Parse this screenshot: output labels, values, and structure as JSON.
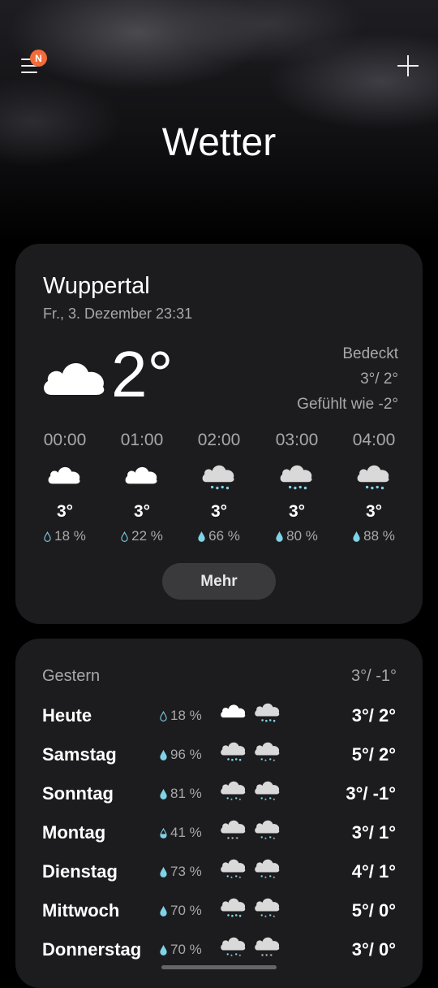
{
  "header": {
    "menu_badge": "N",
    "title": "Wetter"
  },
  "current": {
    "city": "Wuppertal",
    "datetime": "Fr., 3. Dezember 23:31",
    "temperature": "2°",
    "condition": "Bedeckt",
    "high_low": "3°/ 2°",
    "feels_like": "Gefühlt wie -2°",
    "icon": "cloud-icon",
    "more_label": "Mehr"
  },
  "hourly": [
    {
      "time": "00:00",
      "icon": "cloud",
      "temp": "3°",
      "precip": "18 %"
    },
    {
      "time": "01:00",
      "icon": "cloud",
      "temp": "3°",
      "precip": "22 %"
    },
    {
      "time": "02:00",
      "icon": "rain",
      "temp": "3°",
      "precip": "66 %"
    },
    {
      "time": "03:00",
      "icon": "rain",
      "temp": "3°",
      "precip": "80 %"
    },
    {
      "time": "04:00",
      "icon": "rain",
      "temp": "3°",
      "precip": "88 %"
    }
  ],
  "forecast": {
    "yesterday_label": "Gestern",
    "yesterday_range": "3°/ -1°",
    "days": [
      {
        "name": "Heute",
        "precip": "18 %",
        "icons": [
          "cloud",
          "rain"
        ],
        "range": "3°/ 2°"
      },
      {
        "name": "Samstag",
        "precip": "96 %",
        "icons": [
          "rain",
          "sleet"
        ],
        "range": "5°/ 2°"
      },
      {
        "name": "Sonntag",
        "precip": "81 %",
        "icons": [
          "sleet",
          "sleet"
        ],
        "range": "3°/ -1°"
      },
      {
        "name": "Montag",
        "precip": "41 %",
        "icons": [
          "snow",
          "sleet"
        ],
        "range": "3°/ 1°"
      },
      {
        "name": "Dienstag",
        "precip": "73 %",
        "icons": [
          "sleet",
          "sleet"
        ],
        "range": "4°/ 1°"
      },
      {
        "name": "Mittwoch",
        "precip": "70 %",
        "icons": [
          "rain",
          "sleet"
        ],
        "range": "5°/ 0°"
      },
      {
        "name": "Donnerstag",
        "precip": "70 %",
        "icons": [
          "sleet",
          "snow"
        ],
        "range": "3°/ 0°"
      }
    ]
  },
  "colors": {
    "accent_badge": "#f26b3a",
    "card_bg": "#1c1c1e",
    "rain_drop": "#7fd3e6"
  }
}
